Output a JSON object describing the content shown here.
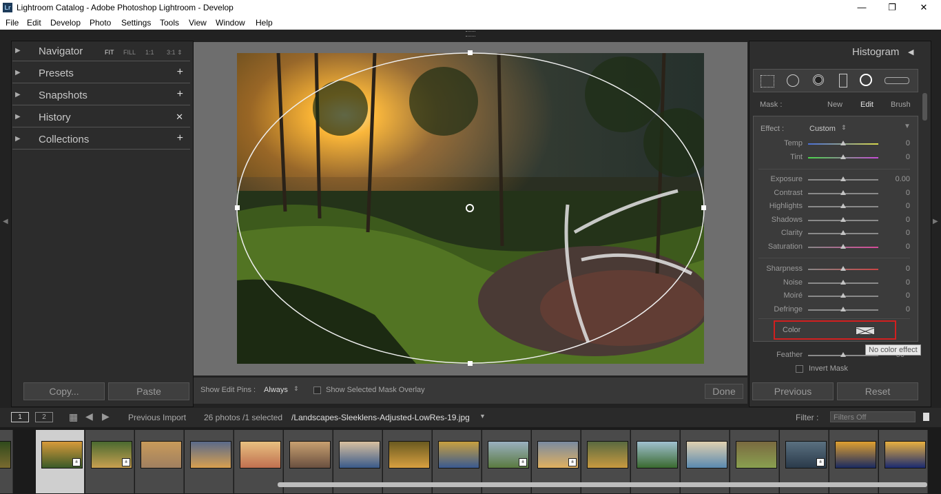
{
  "window": {
    "title": "Lightroom Catalog - Adobe Photoshop Lightroom - Develop",
    "app_icon": "Lr",
    "controls": [
      "—",
      "❐",
      "✕"
    ]
  },
  "menu": [
    "File",
    "Edit",
    "Develop",
    "Photo",
    "Settings",
    "Tools",
    "View",
    "Window",
    "Help"
  ],
  "left_panel": {
    "navigator": {
      "label": "Navigator",
      "opts": [
        "FIT",
        "FILL",
        "1:1",
        "3:1 ⇕"
      ]
    },
    "presets": {
      "label": "Presets",
      "action": "+"
    },
    "snapshots": {
      "label": "Snapshots",
      "action": "+"
    },
    "history": {
      "label": "History",
      "action": "✕"
    },
    "collections": {
      "label": "Collections",
      "action": "+"
    },
    "copy_label": "Copy...",
    "paste_label": "Paste"
  },
  "center_toolbar": {
    "show_edit_pins_label": "Show Edit Pins :",
    "show_edit_pins_value": "Always",
    "mask_overlay_label": "Show Selected Mask Overlay",
    "done_label": "Done"
  },
  "right_panel": {
    "histogram_label": "Histogram",
    "mask_label": "Mask :",
    "mask_new": "New",
    "mask_edit": "Edit",
    "mask_brush": "Brush",
    "effect_label": "Effect :",
    "effect_value": "Custom",
    "sliders_group1": [
      {
        "name": "Temp",
        "value": "0"
      },
      {
        "name": "Tint",
        "value": "0"
      }
    ],
    "sliders_group2": [
      {
        "name": "Exposure",
        "value": "0.00"
      },
      {
        "name": "Contrast",
        "value": "0"
      },
      {
        "name": "Highlights",
        "value": "0"
      },
      {
        "name": "Shadows",
        "value": "0"
      },
      {
        "name": "Clarity",
        "value": "0"
      },
      {
        "name": "Saturation",
        "value": "0"
      }
    ],
    "sliders_group3": [
      {
        "name": "Sharpness",
        "value": "0"
      },
      {
        "name": "Noise",
        "value": "0"
      },
      {
        "name": "Moiré",
        "value": "0"
      },
      {
        "name": "Defringe",
        "value": "0"
      }
    ],
    "color_label": "Color",
    "tooltip": "No color effect",
    "feather_label": "Feather",
    "feather_value": "50",
    "invert_label": "Invert Mask",
    "previous_label": "Previous",
    "reset_label": "Reset"
  },
  "filmstrip_bar": {
    "view1": "1",
    "view2": "2",
    "source": "Previous Import",
    "count": "26 photos /1 selected",
    "filename": "/Landscapes-Sleeklens-Adjusted-LowRes-19.jpg",
    "filter_label": "Filter :",
    "filter_value": "Filters Off"
  },
  "colors": {
    "accent_red": "#d31f1f",
    "panel_bg": "#2e2e2e",
    "work_bg": "#6e6e6e"
  }
}
